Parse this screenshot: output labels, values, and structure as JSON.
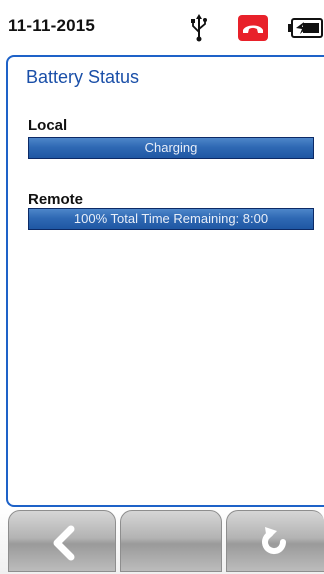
{
  "status_bar": {
    "date": "11-11-2015",
    "icons": [
      "usb-icon",
      "phone-hangup-icon",
      "battery-charging-icon"
    ],
    "phone_color": "#e8212a"
  },
  "page": {
    "title": "Battery Status",
    "local": {
      "label": "Local",
      "value": "Charging"
    },
    "remote": {
      "label": "Remote",
      "value": "100% Total Time Remaining: 8:00"
    }
  },
  "nav": {
    "buttons": [
      "back-icon",
      "blank",
      "refresh-icon"
    ]
  },
  "colors": {
    "accent": "#1e62c8",
    "title": "#1a4fa8",
    "bar": "#2f69b4"
  }
}
